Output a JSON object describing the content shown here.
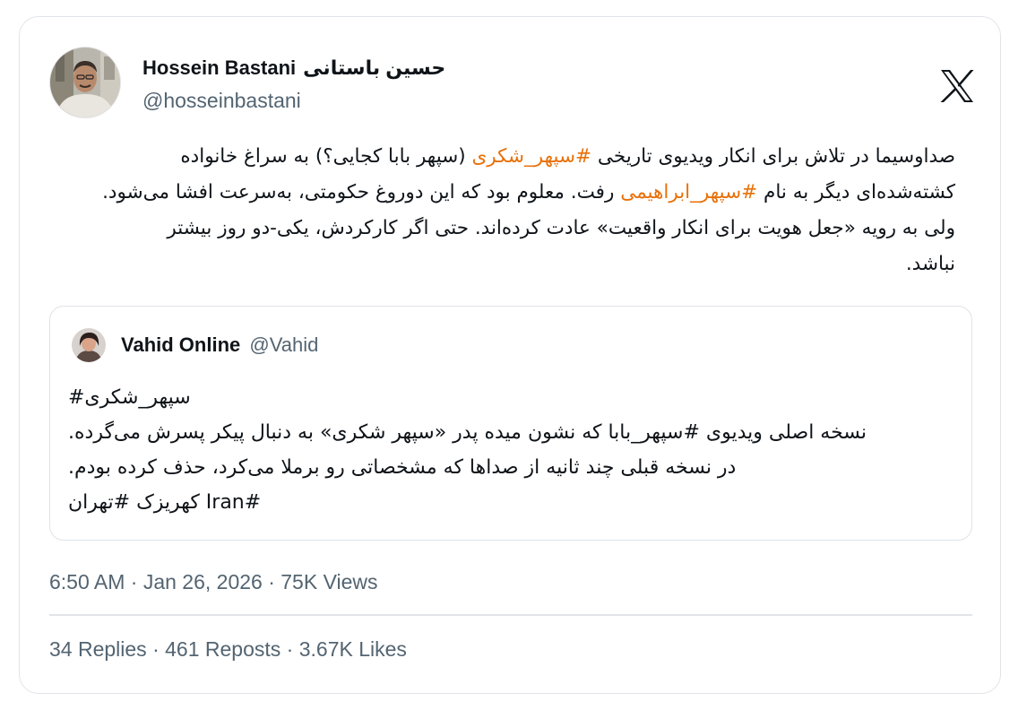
{
  "author": {
    "name": "Hossein Bastani",
    "name_fa": "حسین باستانی",
    "handle": "@hosseinbastani"
  },
  "brand_icon": "x-logo-icon",
  "tweet": {
    "lines": [
      [
        "صداوسیما در تلاش برای انکار ویدیوی تاریخی ",
        {
          "hashtag": "#سپهر_شکری"
        },
        " (سپهر بابا کجایی؟) به سراغ خانواده"
      ],
      [
        "کشته‌شده‌ای دیگر به نام ",
        {
          "hashtag": "#سپهر_ابراهیمی"
        },
        " رفت. معلوم بود که این دوروغ حکومتی، به‌سرعت افشا می‌شود."
      ],
      [
        "ولی به رویه «جعل هویت برای انکار واقعیت» عادت کرده‌اند. حتی اگر کارکردش، یکی-دو روز بیشتر"
      ],
      [
        "نباشد."
      ]
    ]
  },
  "quote": {
    "name": "Vahid Online",
    "handle": "@Vahid",
    "lines": [
      "سپهر_شکری#",
      "نسخه اصلی ویدیوی #سپهر_بابا که نشون میده پدر «سپهر شکری» به دنبال پیکر پسرش می‌گرده.",
      "در نسخه قبلی چند ثانیه از صداها که مشخصاتی رو برملا می‌کرد، حذف کرده بودم.",
      "#Iran کهریزک #تهران"
    ]
  },
  "meta": "6:50 AM · Jan 26, 2026 · 75K Views",
  "stats": {
    "replies": "34 Replies",
    "reposts": "461 Reposts",
    "likes": "3.67K Likes",
    "separator": " · "
  },
  "colors": {
    "hashtag": "#e8710a",
    "secondary_text": "#536471",
    "border": "#e1e4e8"
  }
}
